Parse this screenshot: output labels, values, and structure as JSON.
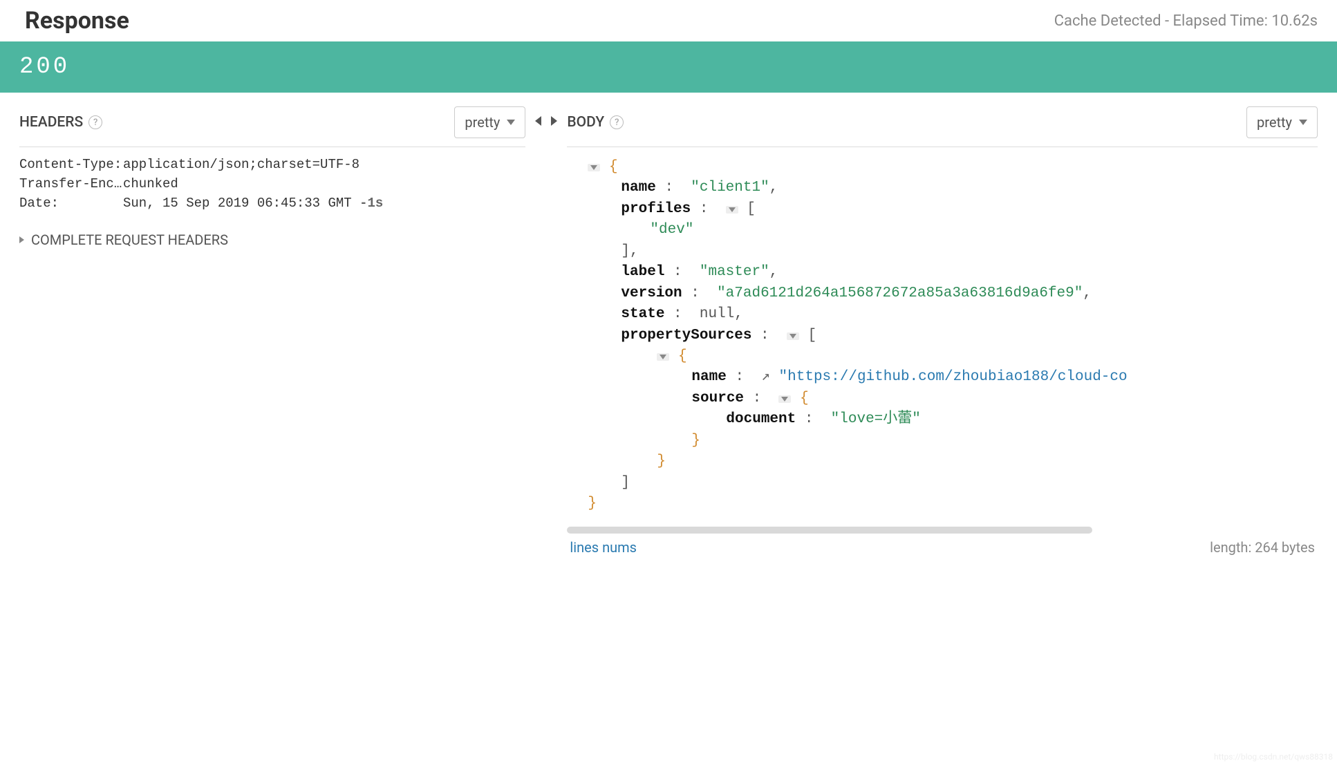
{
  "header": {
    "title": "Response",
    "cache_info": "Cache Detected - Elapsed Time: 10.62s"
  },
  "status": {
    "code": "200"
  },
  "left": {
    "label": "HEADERS",
    "format": "pretty",
    "headers": [
      {
        "key": "Content-Type:",
        "value": "application/json;charset=UTF-8"
      },
      {
        "key": "Transfer-Enc…",
        "value": "chunked"
      },
      {
        "key": "Date:",
        "value": "Sun, 15 Sep 2019 06:45:33 GMT",
        "delta": "-1s"
      }
    ],
    "complete_headers": "COMPLETE REQUEST HEADERS"
  },
  "right": {
    "label": "BODY",
    "format": "pretty",
    "footer": {
      "lines_nums": "lines nums",
      "length": "length: 264 bytes"
    }
  },
  "json": {
    "name_key": "name",
    "name_val": "\"client1\"",
    "profiles_key": "profiles",
    "profiles_item": "\"dev\"",
    "label_key": "label",
    "label_val": "\"master\"",
    "version_key": "version",
    "version_val": "\"a7ad6121d264a156872672a85a3a63816d9a6fe9\"",
    "state_key": "state",
    "state_val": "null",
    "propsrc_key": "propertySources",
    "ps_name_key": "name",
    "ps_name_url": "\"https://github.com/zhoubiao188/cloud-co",
    "ps_source_key": "source",
    "ps_doc_key": "document",
    "ps_doc_val": "\"love=小蕾\""
  },
  "watermark": "https://blog.csdn.net/qws88318"
}
